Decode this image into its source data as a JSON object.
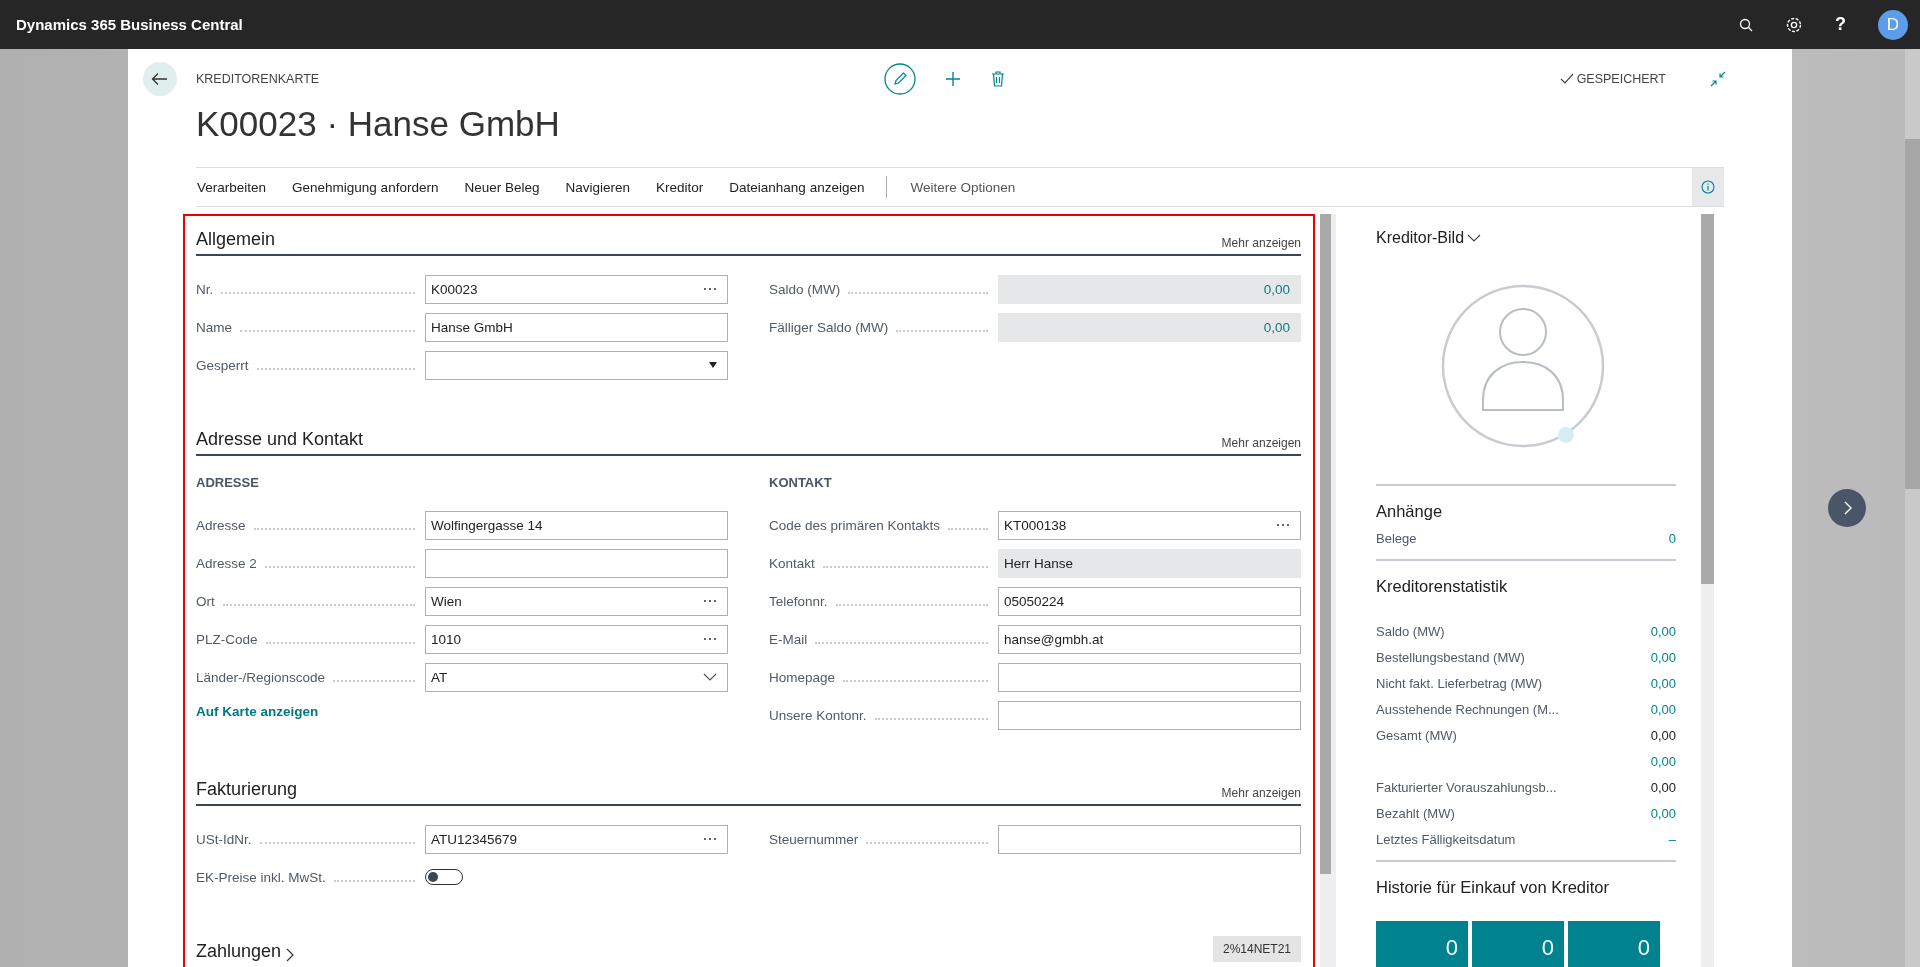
{
  "app_bar": {
    "title": "Dynamics 365 Business Central",
    "help": "?",
    "avatar": "D"
  },
  "page": {
    "caption": "KREDITORENKARTE",
    "title": "K00023 · Hanse GmbH",
    "saved_status": "GESPEICHERT"
  },
  "actions": [
    {
      "label": "Verarbeiten"
    },
    {
      "label": "Genehmigung anfordern"
    },
    {
      "label": "Neuer Beleg"
    },
    {
      "label": "Navigieren"
    },
    {
      "label": "Kreditor"
    },
    {
      "label": "Dateianhang anzeigen"
    }
  ],
  "more_options": "Weitere Optionen",
  "sections": [
    {
      "title": "Allgemein",
      "show_more": "Mehr anzeigen",
      "expanded": true,
      "columns": [
        {
          "fields": [
            {
              "label": "Nr.",
              "value": "K00023",
              "kind": "lookup"
            },
            {
              "label": "Name",
              "value": "Hanse GmbH",
              "kind": "text"
            },
            {
              "label": "Gesperrt",
              "kind": "dropdown"
            }
          ]
        },
        {
          "fields": [
            {
              "label": "Saldo (MW)",
              "value": "0,00",
              "kind": "amount"
            },
            {
              "label": "Fälliger Saldo (MW)",
              "value": "0,00",
              "kind": "amount"
            }
          ]
        }
      ]
    },
    {
      "title": "Adresse und Kontakt",
      "show_more": "Mehr anzeigen",
      "expanded": true,
      "columns": [
        {
          "heading": "ADRESSE",
          "fields": [
            {
              "label": "Adresse",
              "value": "Wolfingergasse 14",
              "kind": "text"
            },
            {
              "label": "Adresse 2",
              "kind": "text"
            },
            {
              "label": "Ort",
              "value": "Wien",
              "kind": "lookup"
            },
            {
              "label": "PLZ-Code",
              "value": "1010",
              "kind": "lookup"
            },
            {
              "label": "Länder-/Regionscode",
              "value": "AT",
              "kind": "select"
            }
          ],
          "link": "Auf Karte anzeigen"
        },
        {
          "heading": "KONTAKT",
          "fields": [
            {
              "label": "Code des primären Kontakts",
              "value": "KT000138",
              "kind": "lookup"
            },
            {
              "label": "Kontakt",
              "value": "Herr Hanse",
              "kind": "readonly"
            },
            {
              "label": "Telefonnr.",
              "value": "05050224",
              "kind": "text"
            },
            {
              "label": "E-Mail",
              "value": "hanse@gmbh.at",
              "kind": "text"
            },
            {
              "label": "Homepage",
              "kind": "text"
            },
            {
              "label": "Unsere Kontonr.",
              "kind": "text"
            }
          ]
        }
      ]
    },
    {
      "title": "Fakturierung",
      "show_more": "Mehr anzeigen",
      "expanded": true,
      "columns": [
        {
          "fields": [
            {
              "label": "USt-IdNr.",
              "value": "ATU12345679",
              "kind": "lookup"
            },
            {
              "label": "EK-Preise inkl. MwSt.",
              "kind": "toggle",
              "on": false
            }
          ]
        },
        {
          "fields": [
            {
              "label": "Steuernummer",
              "kind": "text"
            }
          ]
        }
      ]
    },
    {
      "title": "Zahlungen",
      "expanded": false,
      "summary": "2%14NET21"
    }
  ],
  "factbox": {
    "title": "Kreditor-Bild",
    "attachments": {
      "title": "Anhänge",
      "rows": [
        {
          "label": "Belege",
          "value": "0",
          "drilldown": true
        }
      ]
    },
    "statistics": {
      "title": "Kreditorenstatistik",
      "rows": [
        {
          "label": "Saldo (MW)",
          "value": "0,00",
          "drilldown": true
        },
        {
          "label": "Bestellungsbestand (MW)",
          "value": "0,00",
          "drilldown": true
        },
        {
          "label": "Nicht fakt. Lieferbetrag (MW)",
          "value": "0,00",
          "drilldown": true
        },
        {
          "label": "Ausstehende Rechnungen (M...",
          "value": "0,00",
          "drilldown": true
        },
        {
          "label": "Gesamt (MW)",
          "value": "0,00",
          "drilldown": false
        },
        {
          "value": "0,00",
          "drilldown": true
        },
        {
          "label": "Fakturierter Vorauszahlungsb...",
          "value": "0,00",
          "drilldown": false
        },
        {
          "label": "Bezahlt (MW)",
          "value": "0,00",
          "drilldown": true
        },
        {
          "label": "Letztes Fälligkeitsdatum",
          "value": "–",
          "drilldown": true
        }
      ]
    },
    "history": {
      "title": "Historie für Einkauf von Kreditor",
      "tiles": [
        "0",
        "0",
        "0"
      ]
    }
  }
}
